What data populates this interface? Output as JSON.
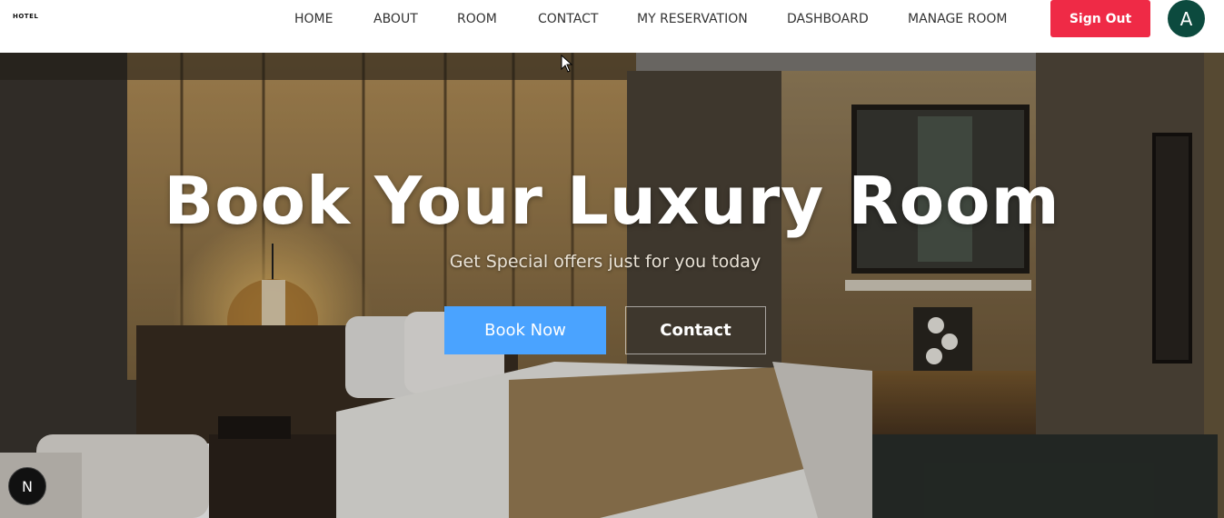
{
  "navbar": {
    "logo": "HOTEL",
    "links": [
      {
        "label": "HOME"
      },
      {
        "label": "ABOUT"
      },
      {
        "label": "ROOM"
      },
      {
        "label": "CONTACT"
      },
      {
        "label": "MY RESERVATION"
      },
      {
        "label": "DASHBOARD"
      },
      {
        "label": "MANAGE ROOM"
      }
    ],
    "signout_label": "Sign Out",
    "avatar_letter": "A"
  },
  "hero": {
    "title": "Book Your Luxury Room",
    "subtitle": "Get Special offers just for you today",
    "book_button": "Book Now",
    "contact_button": "Contact"
  },
  "dev_badge": "N",
  "colors": {
    "signout_bg": "#ef2a46",
    "avatar_bg": "#0c4a3e",
    "book_button_bg": "#4aa3ff"
  },
  "icons": {
    "dev_badge": "nextjs-icon",
    "cursor": "mouse-cursor-icon"
  }
}
